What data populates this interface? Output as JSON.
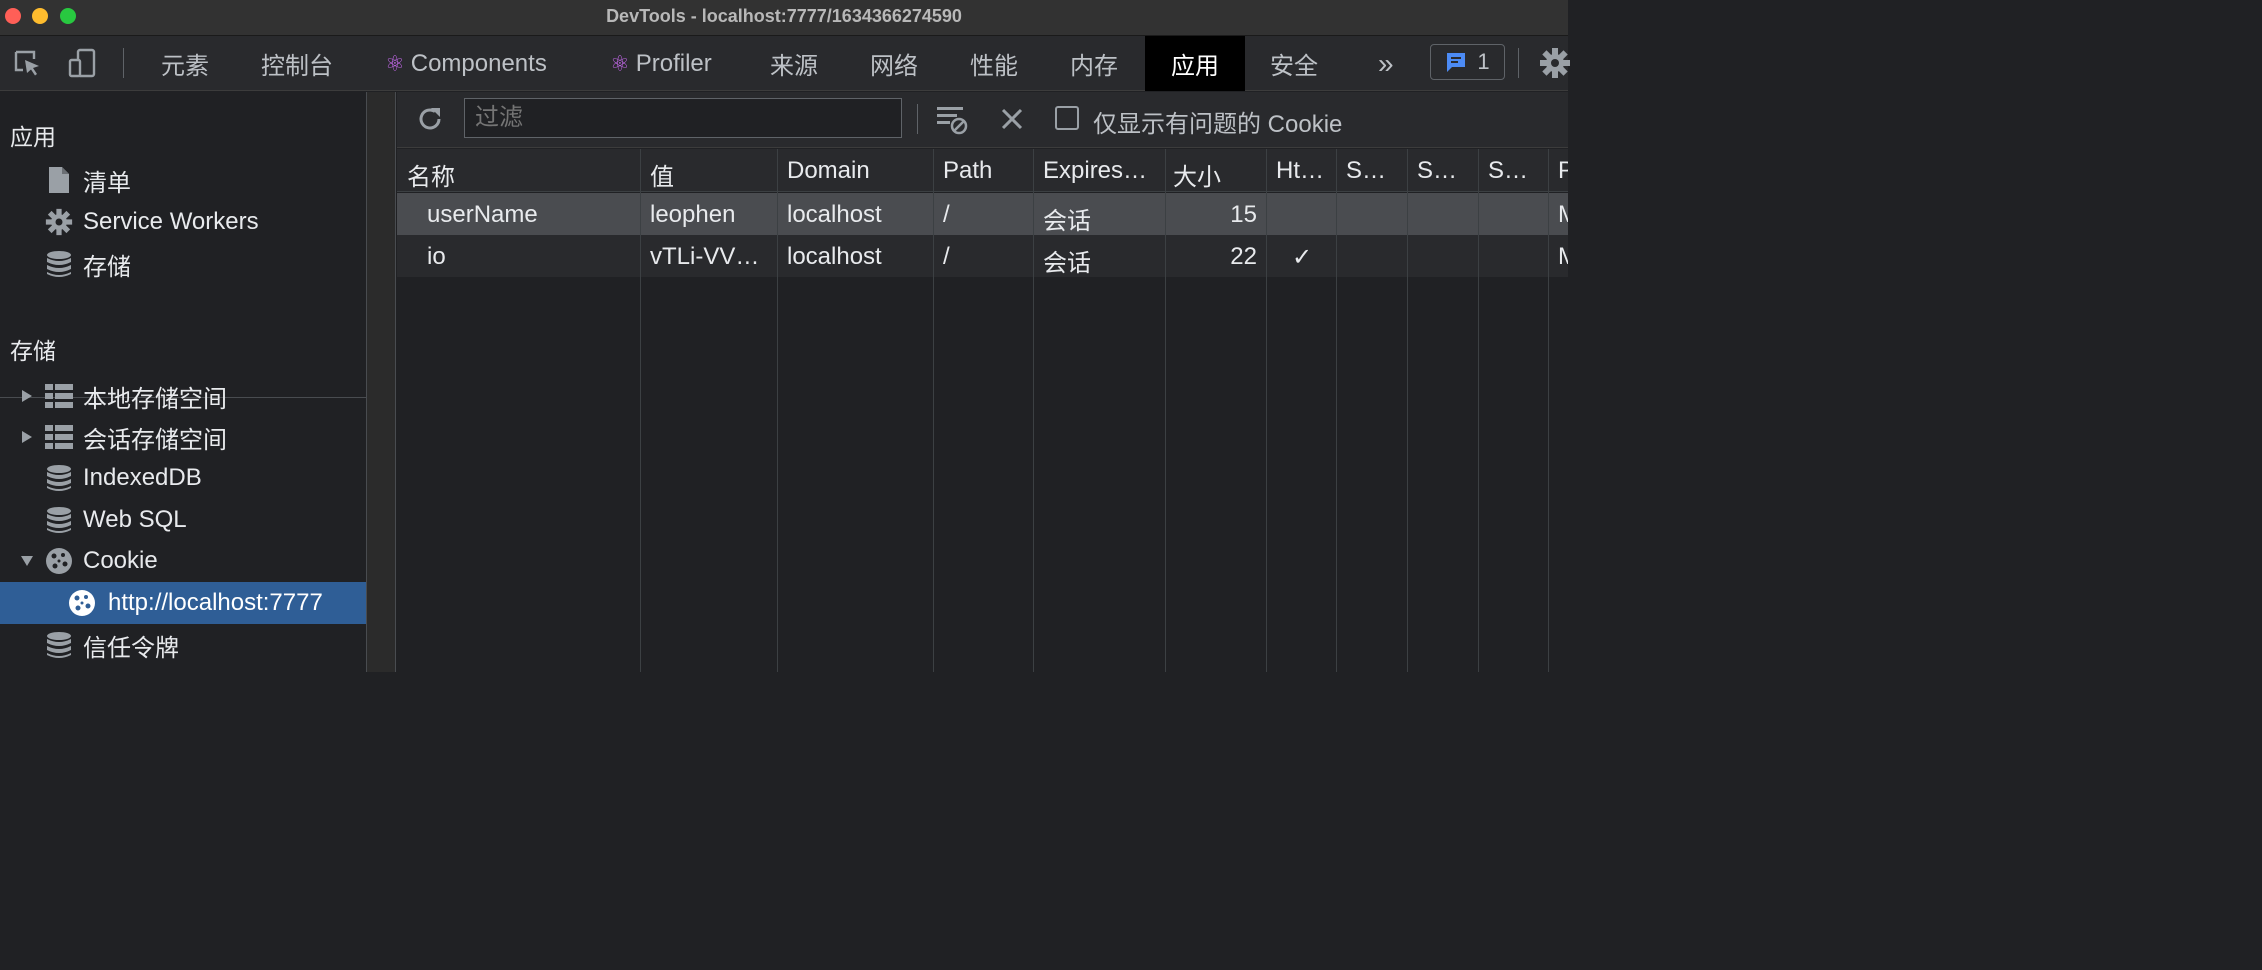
{
  "window": {
    "title": "DevTools - localhost:7777/1634366274590"
  },
  "tabs": [
    {
      "label": "元素"
    },
    {
      "label": "控制台"
    },
    {
      "label": "Components",
      "icon": "react-icon"
    },
    {
      "label": "Profiler",
      "icon": "react-icon"
    },
    {
      "label": "来源"
    },
    {
      "label": "网络"
    },
    {
      "label": "性能"
    },
    {
      "label": "内存"
    },
    {
      "label": "应用",
      "active": true
    },
    {
      "label": "安全"
    }
  ],
  "tabbar": {
    "more_icon": "»",
    "issues_count": "1"
  },
  "sidebar": {
    "app_heading": "应用",
    "app_items": [
      {
        "label": "清单",
        "icon": "file-icon"
      },
      {
        "label": "Service Workers",
        "icon": "gear-icon"
      },
      {
        "label": "存储",
        "icon": "database-icon"
      }
    ],
    "storage_heading": "存储",
    "storage_items": [
      {
        "label": "本地存储空间",
        "icon": "table-icon",
        "expandable": true
      },
      {
        "label": "会话存储空间",
        "icon": "table-icon",
        "expandable": true
      },
      {
        "label": "IndexedDB",
        "icon": "database-icon"
      },
      {
        "label": "Web SQL",
        "icon": "database-icon"
      },
      {
        "label": "Cookie",
        "icon": "cookie-icon",
        "expanded": true
      },
      {
        "label": "http://localhost:7777",
        "icon": "cookie-icon",
        "selected": true
      },
      {
        "label": "信任令牌",
        "icon": "database-icon"
      }
    ]
  },
  "toolbar": {
    "filter_placeholder": "过滤",
    "only_issues_label": "仅显示有问题的 Cookie"
  },
  "table": {
    "columns": [
      "名称",
      "值",
      "Domain",
      "Path",
      "Expires…",
      "大小",
      "Ht…",
      "S…",
      "S…",
      "S…",
      "P"
    ],
    "rows": [
      {
        "name": "userName",
        "value": "leophen",
        "domain": "localhost",
        "path": "/",
        "expires": "会话",
        "size": "15",
        "httponly": "",
        "trail": "M"
      },
      {
        "name": "io",
        "value": "vTLi-VV…",
        "domain": "localhost",
        "path": "/",
        "expires": "会话",
        "size": "22",
        "httponly": "✓",
        "trail": "M"
      }
    ]
  },
  "colors": {
    "active_tab": "#000000",
    "selected_item": "#2f5e96",
    "react_icon": "#c86af0",
    "issues_icon": "#4c8bf5"
  }
}
